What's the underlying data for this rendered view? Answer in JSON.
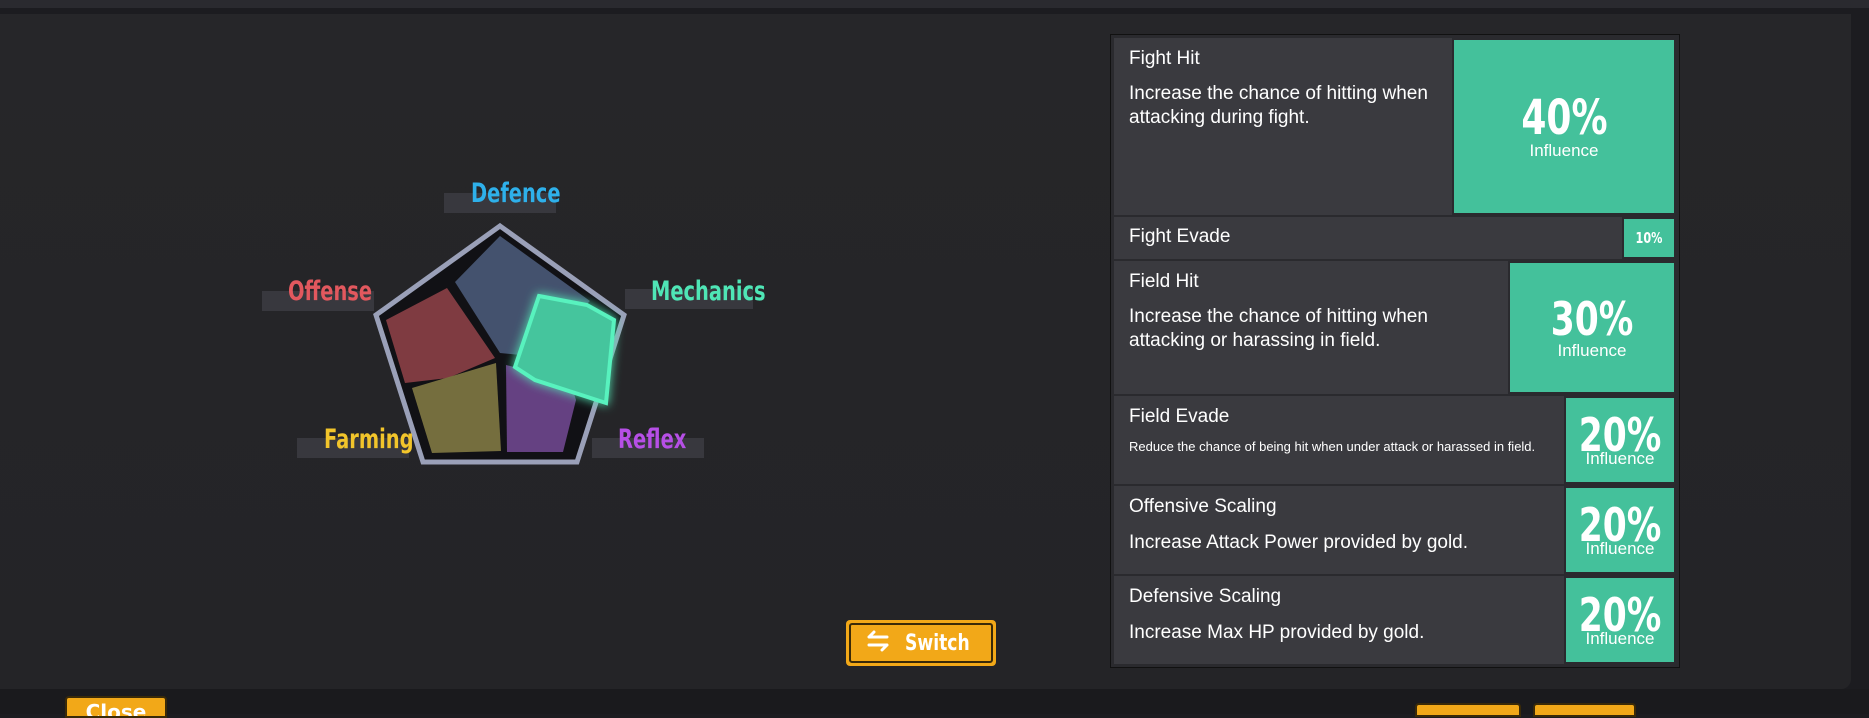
{
  "colors": {
    "accent_teal": "#44c19b",
    "button_orange": "#f2a818",
    "defence": "#2eb0ea",
    "offense": "#e2585e",
    "mechanics": "#4fe6b6",
    "farming": "#f2c52b",
    "reflex": "#b64fe6"
  },
  "pentagon": {
    "labels": {
      "defence": "Defence",
      "offense": "Offense",
      "mechanics": "Mechanics",
      "farming": "Farming",
      "reflex": "Reflex"
    },
    "selected": "mechanics"
  },
  "switch_button": {
    "label": "Switch",
    "icon": "swap-arrows-icon"
  },
  "close_button": {
    "label": "Close"
  },
  "stats": [
    {
      "name": "Fight Hit",
      "description": "Increase the chance of hitting when attacking during fight.",
      "percent": "40%",
      "influence": "Influence"
    },
    {
      "name": "Fight Evade",
      "description": "",
      "percent": "10%",
      "influence": ""
    },
    {
      "name": "Field Hit",
      "description": "Increase the chance of hitting when attacking or harassing in field.",
      "percent": "30%",
      "influence": "Influence"
    },
    {
      "name": "Field Evade",
      "description": "Reduce the chance of being hit when under attack or harassed in field.",
      "percent": "20%",
      "influence": "Influence"
    },
    {
      "name": "Offensive Scaling",
      "description": "Increase Attack Power provided by gold.",
      "percent": "20%",
      "influence": "Influence"
    },
    {
      "name": "Defensive Scaling",
      "description": "Increase Max HP provided by gold.",
      "percent": "20%",
      "influence": "Influence"
    }
  ]
}
